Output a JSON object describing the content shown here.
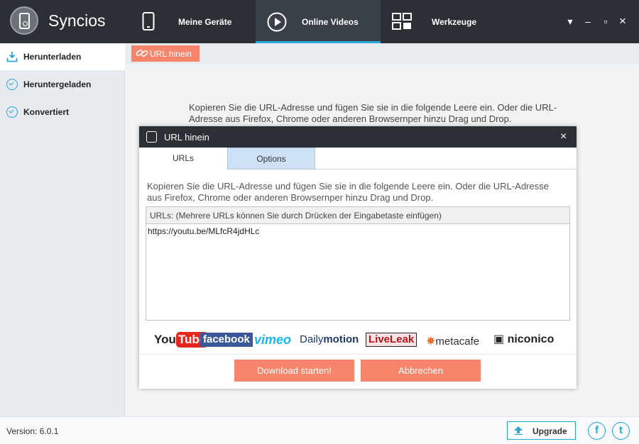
{
  "app": {
    "title": "Syncios"
  },
  "nav": {
    "tabs": [
      {
        "label": "Meine Geräte",
        "icon": "phone-icon"
      },
      {
        "label": "Online Videos",
        "icon": "play-icon",
        "active": true
      },
      {
        "label": "Werkzeuge",
        "icon": "grid-icon"
      }
    ]
  },
  "window_controls": {
    "menu": "▾",
    "minimize": "–",
    "maximize": "▫",
    "close": "×"
  },
  "sidebar": {
    "items": [
      {
        "label": "Herunterladen",
        "icon": "download-icon",
        "active": true
      },
      {
        "label": "Heruntergeladen",
        "icon": "check-circle-icon"
      },
      {
        "label": "Konvertiert",
        "icon": "check-circle-icon"
      }
    ]
  },
  "toolbar": {
    "url_button_label": "URL hinein"
  },
  "background_text": "Kopieren Sie die URL-Adresse und fügen Sie sie in die folgende Leere ein. Oder die URL-Adresse aus Firefox, Chrome oder anderen Browsernper hinzu Drag und Drop.",
  "dialog": {
    "title": "URL hinein",
    "close": "×",
    "tabs": [
      {
        "label": "URLs",
        "active": true
      },
      {
        "label": "Options"
      }
    ],
    "instructions": "Kopieren Sie die URL-Adresse und fügen Sie sie in die folgende Leere ein. Oder die URL-Adresse aus Firefox, Chrome oder anderen Browsernper hinzu Drag und Drop.",
    "urls_header": "URLs: (Mehrere URLs können Sie durch Drücken der Eingabetaste einfügen)",
    "url_value": "https://youtu.be/MLfcR4jdHLc",
    "logos": {
      "youtube_a": "You",
      "youtube_b": "Tube",
      "facebook": "facebook",
      "vimeo": "vimeo",
      "dailymotion_a": "Daily",
      "dailymotion_b": "motion",
      "liveleak": "LiveLeak",
      "metacafe": "metacafe",
      "niconico": "niconico"
    },
    "download_button": "Download starten!",
    "cancel_button": "Abbrechen"
  },
  "status": {
    "version": "Version: 6.0.1",
    "upgrade_label": "Upgrade",
    "facebook_glyph": "f",
    "twitter_glyph": "t"
  },
  "colors": {
    "accent": "#27a6d8",
    "button": "#f7856c",
    "header": "#2b3036"
  }
}
